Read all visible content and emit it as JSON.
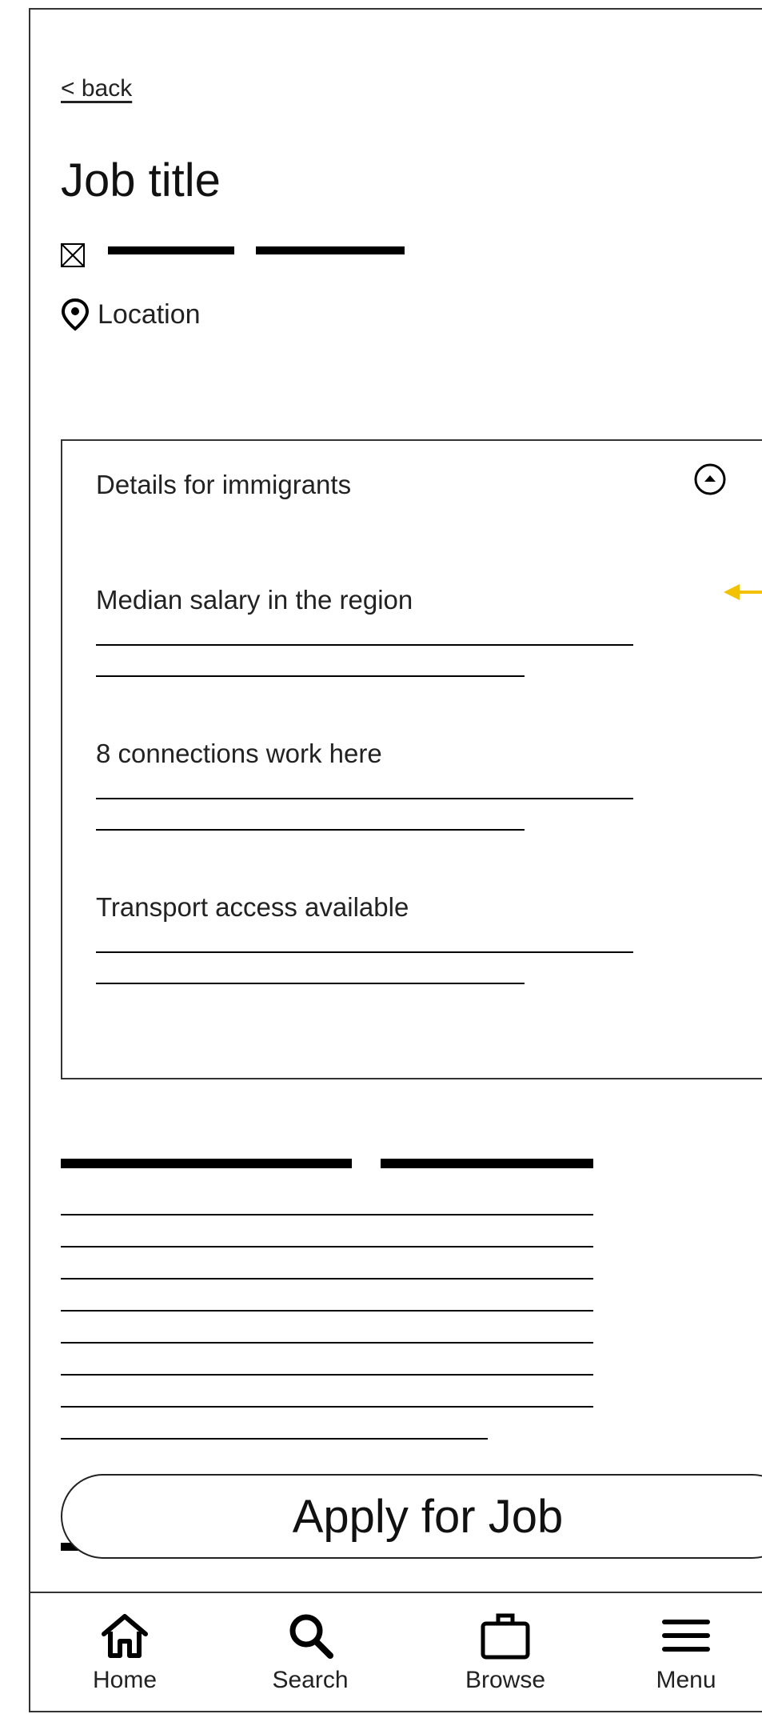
{
  "header": {
    "back_label": "< back",
    "job_title": "Job title",
    "location": "Location"
  },
  "details": {
    "title": "Details for immigrants",
    "sections": [
      {
        "label": "Median salary in the region"
      },
      {
        "label": "8 connections work here"
      },
      {
        "label": "Transport access available"
      }
    ]
  },
  "actions": {
    "apply_label": "Apply for Job"
  },
  "nav": {
    "items": [
      {
        "label": "Home",
        "icon": "home-icon"
      },
      {
        "label": "Search",
        "icon": "search-icon"
      },
      {
        "label": "Browse",
        "icon": "briefcase-icon"
      },
      {
        "label": "Menu",
        "icon": "hamburger-icon"
      }
    ]
  },
  "colors": {
    "annotation_arrow": "#f2c200"
  }
}
